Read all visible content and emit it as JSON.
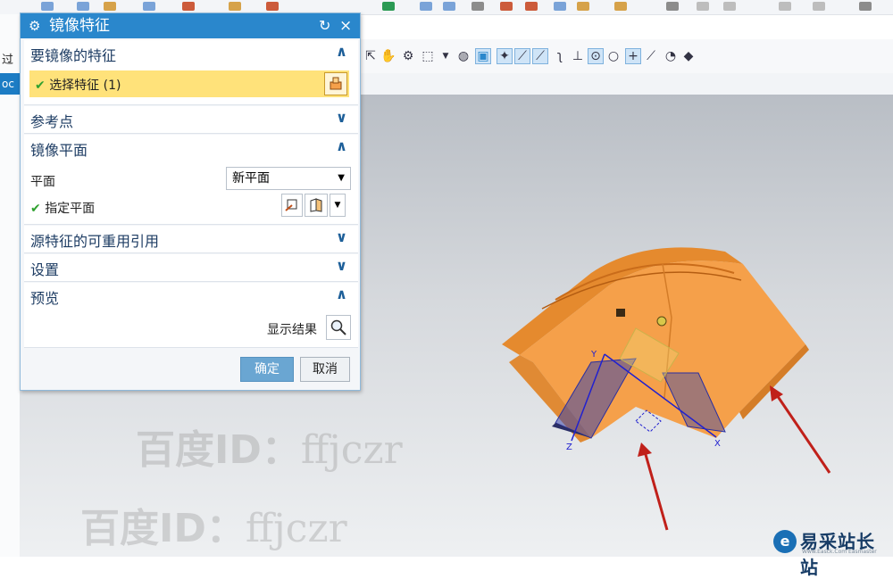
{
  "dialog": {
    "title": "镜像特征",
    "gear_icon": "gear-icon",
    "reset_icon": "reset-icon",
    "close_icon": "×",
    "sections": {
      "features": {
        "title": "要镜像的特征",
        "chevron": "∧",
        "selection_label": "选择特征 (1)"
      },
      "reference_point": {
        "title": "参考点",
        "chevron": "∨"
      },
      "mirror_plane": {
        "title": "镜像平面",
        "chevron": "∧",
        "plane_label": "平面",
        "plane_value": "新平面",
        "specify_label": "指定平面"
      },
      "reuse_refs": {
        "title": "源特征的可重用引用",
        "chevron": "∨"
      },
      "settings": {
        "title": "设置",
        "chevron": "∨"
      },
      "preview": {
        "title": "预览",
        "chevron": "∧",
        "show_result_label": "显示结果"
      }
    },
    "ok_label": "确定",
    "cancel_label": "取消"
  },
  "left_strip": {
    "top_label": "过",
    "blue_label": "oc"
  },
  "watermark": {
    "text_bold": "百度ID：",
    "text": "ffjczr"
  },
  "logo": {
    "name": "易采站长站",
    "sub": "Www.Easck.Com  Easmaster"
  },
  "viewport": {
    "axis_x": "X",
    "axis_y": "Y",
    "axis_z": "Z"
  },
  "colors": {
    "part_orange": "#f5a04a",
    "title_blue": "#2a87cc",
    "selection_yellow": "#ffe27a",
    "arrow_red": "#c0201a"
  }
}
